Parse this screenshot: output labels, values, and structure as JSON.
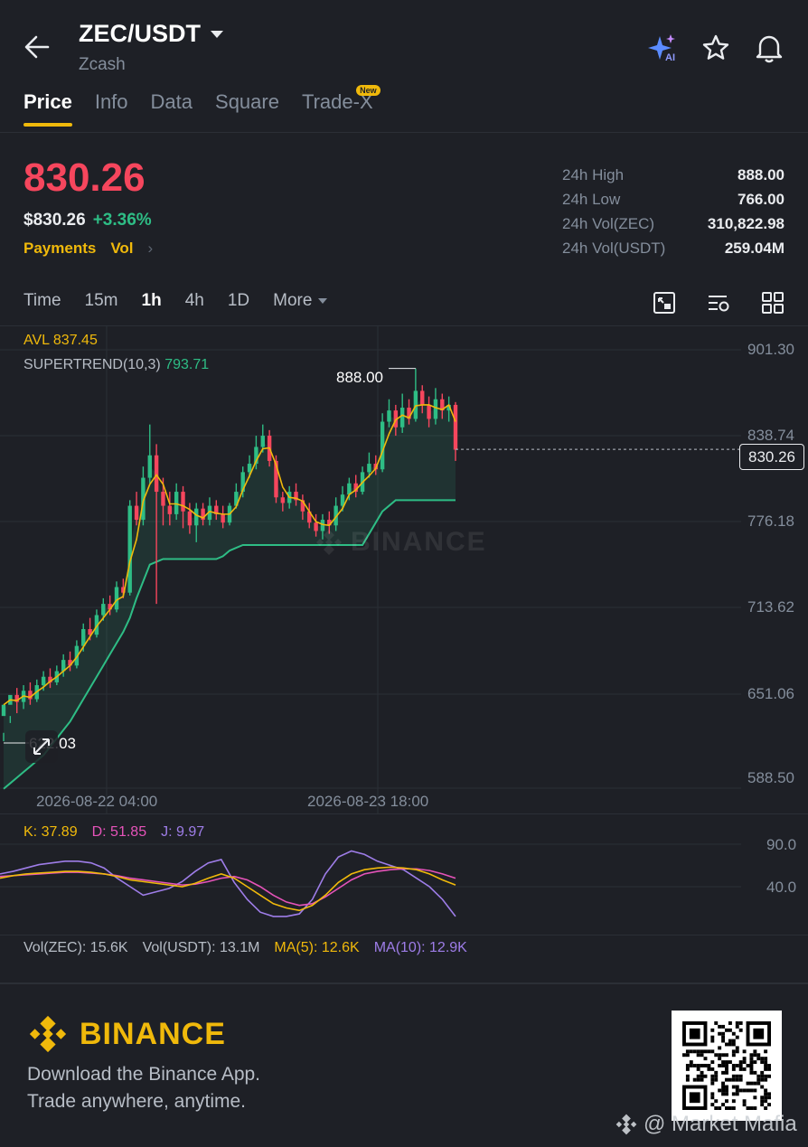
{
  "header": {
    "pair": "ZEC/USDT",
    "name": "Zcash"
  },
  "tabs": [
    {
      "label": "Price",
      "active": true
    },
    {
      "label": "Info"
    },
    {
      "label": "Data"
    },
    {
      "label": "Square"
    },
    {
      "label": "Trade-X",
      "badge": "New"
    }
  ],
  "price": {
    "last": "830.26",
    "usd": "$830.26",
    "change": "+3.36%",
    "links": [
      "Payments",
      "Vol"
    ]
  },
  "stats": [
    {
      "label": "24h High",
      "value": "888.00"
    },
    {
      "label": "24h Low",
      "value": "766.00"
    },
    {
      "label": "24h Vol(ZEC)",
      "value": "310,822.98"
    },
    {
      "label": "24h Vol(USDT)",
      "value": "259.04M"
    }
  ],
  "timeframes": [
    "Time",
    "15m",
    "1h",
    "4h",
    "1D",
    "More"
  ],
  "active_timeframe": "1h",
  "indicators": {
    "avl": "AVL 837.45",
    "supertrend_label": "SUPERTREND(10,3)",
    "supertrend_value": "793.71",
    "high_label": "888.00",
    "low_label": "622.03",
    "current_tag": "830.26",
    "kdj": {
      "k": "K: 37.89",
      "d": "D: 51.85",
      "j": "J: 9.97"
    },
    "vol": {
      "zec": "Vol(ZEC): 15.6K",
      "usdt": "Vol(USDT): 13.1M",
      "ma5": "MA(5): 12.6K",
      "ma10": "MA(10): 12.9K"
    }
  },
  "colors": {
    "up": "#2ebd85",
    "down": "#f6465d",
    "accent": "#f0b90b",
    "ma": "#f0b90b",
    "k": "#f0b90b",
    "d": "#e553b9",
    "j": "#9e7de8"
  },
  "chart_data": {
    "type": "candlestick",
    "y_axis_ticks": [
      "901.30",
      "838.74",
      "776.18",
      "713.62",
      "651.06",
      "588.50"
    ],
    "ylim": [
      588.5,
      901.3
    ],
    "x_axis_ticks": [
      "2026-08-22 04:00",
      "2026-08-23 18:00"
    ],
    "watermark": "BINANCE",
    "candles": [
      [
        640,
        648,
        628,
        622
      ],
      [
        648,
        655,
        640,
        635
      ],
      [
        655,
        650,
        660,
        642
      ],
      [
        650,
        658,
        662,
        645
      ],
      [
        658,
        652,
        664,
        648
      ],
      [
        652,
        662,
        666,
        650
      ],
      [
        662,
        668,
        672,
        658
      ],
      [
        668,
        664,
        674,
        660
      ],
      [
        664,
        672,
        676,
        662
      ],
      [
        672,
        680,
        684,
        668
      ],
      [
        680,
        676,
        686,
        672
      ],
      [
        676,
        690,
        694,
        674
      ],
      [
        690,
        702,
        706,
        686
      ],
      [
        702,
        698,
        710,
        694
      ],
      [
        698,
        712,
        716,
        696
      ],
      [
        712,
        720,
        724,
        708
      ],
      [
        720,
        716,
        726,
        712
      ],
      [
        716,
        732,
        736,
        714
      ],
      [
        732,
        728,
        738,
        724
      ],
      [
        728,
        790,
        794,
        726
      ],
      [
        790,
        780,
        800,
        776
      ],
      [
        780,
        810,
        818,
        776
      ],
      [
        810,
        826,
        848,
        806
      ],
      [
        826,
        800,
        834,
        720
      ],
      [
        800,
        790,
        810,
        776
      ],
      [
        790,
        784,
        800,
        776
      ],
      [
        784,
        800,
        806,
        780
      ],
      [
        800,
        786,
        804,
        774
      ],
      [
        786,
        776,
        792,
        770
      ],
      [
        776,
        788,
        792,
        764
      ],
      [
        788,
        780,
        792,
        776
      ],
      [
        780,
        790,
        796,
        776
      ],
      [
        790,
        784,
        794,
        780
      ],
      [
        784,
        778,
        790,
        774
      ],
      [
        778,
        790,
        792,
        776
      ],
      [
        790,
        800,
        806,
        788
      ],
      [
        800,
        814,
        818,
        796
      ],
      [
        814,
        820,
        826,
        810
      ],
      [
        820,
        832,
        840,
        816
      ],
      [
        832,
        840,
        848,
        828
      ],
      [
        840,
        822,
        844,
        818
      ],
      [
        822,
        796,
        826,
        792
      ],
      [
        796,
        792,
        800,
        786
      ],
      [
        792,
        800,
        804,
        788
      ],
      [
        800,
        794,
        806,
        790
      ],
      [
        794,
        786,
        798,
        780
      ],
      [
        786,
        778,
        792,
        774
      ],
      [
        778,
        772,
        784,
        768
      ],
      [
        772,
        780,
        784,
        766
      ],
      [
        780,
        776,
        786,
        770
      ],
      [
        776,
        790,
        796,
        772
      ],
      [
        790,
        798,
        804,
        786
      ],
      [
        798,
        806,
        810,
        794
      ],
      [
        806,
        800,
        812,
        796
      ],
      [
        800,
        814,
        818,
        798
      ],
      [
        814,
        820,
        828,
        810
      ],
      [
        820,
        816,
        826,
        812
      ],
      [
        816,
        850,
        856,
        814
      ],
      [
        850,
        858,
        866,
        846
      ],
      [
        858,
        846,
        862,
        840
      ],
      [
        846,
        860,
        870,
        842
      ],
      [
        860,
        852,
        866,
        848
      ],
      [
        852,
        872,
        888,
        850
      ],
      [
        872,
        862,
        876,
        856
      ],
      [
        862,
        852,
        868,
        846
      ],
      [
        852,
        866,
        874,
        848
      ],
      [
        866,
        858,
        870,
        852
      ],
      [
        858,
        862,
        868,
        850
      ],
      [
        862,
        830,
        864,
        822
      ]
    ],
    "supertrend": [
      588,
      592,
      596,
      600,
      604,
      608,
      612,
      618,
      624,
      630,
      636,
      644,
      652,
      660,
      668,
      676,
      684,
      692,
      700,
      710,
      724,
      736,
      748,
      750,
      752,
      752,
      752,
      752,
      752,
      752,
      752,
      752,
      752,
      754,
      758,
      760,
      762,
      762,
      762,
      762,
      762,
      762,
      762,
      762,
      762,
      762,
      762,
      762,
      762,
      762,
      762,
      762,
      762,
      762,
      762,
      770,
      778,
      786,
      790,
      794,
      794,
      794,
      794,
      794,
      794,
      794,
      794,
      794,
      794
    ]
  }
}
